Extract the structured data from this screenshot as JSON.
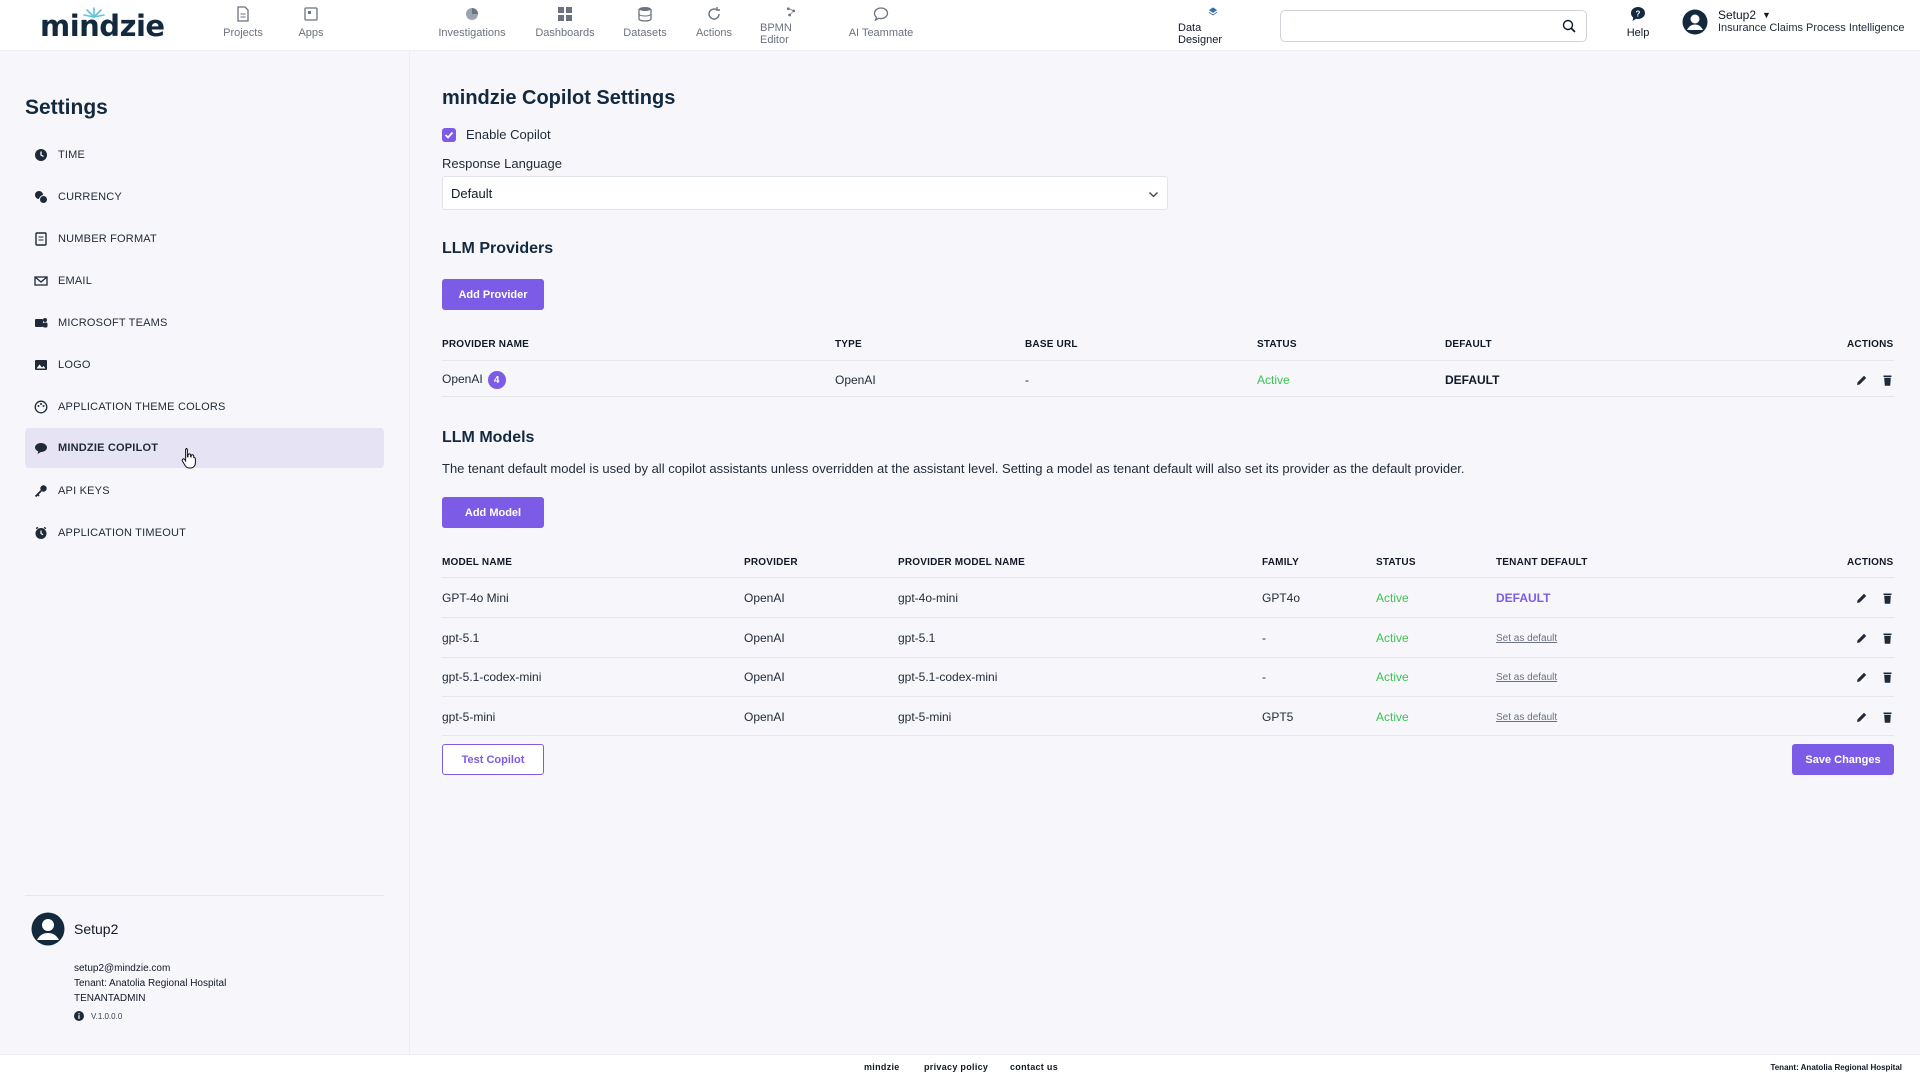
{
  "brand": {
    "logo_text": "mindzie"
  },
  "nav": {
    "items": [
      {
        "label": "Projects",
        "icon": "file-icon"
      },
      {
        "label": "Apps",
        "icon": "app-icon"
      },
      {
        "label": "Investigations",
        "icon": "chart-pie-icon"
      },
      {
        "label": "Dashboards",
        "icon": "grid-icon"
      },
      {
        "label": "Datasets",
        "icon": "database-icon"
      },
      {
        "label": "Actions",
        "icon": "refresh-icon"
      },
      {
        "label": "BPMN Editor",
        "icon": "bpmn-icon"
      },
      {
        "label": "AI Teammate",
        "icon": "chat-icon"
      },
      {
        "label": "Data Designer",
        "icon": "designer-icon"
      },
      {
        "label": "Help",
        "icon": "help-icon"
      }
    ],
    "search_value": "",
    "user_name": "Setup2",
    "user_org": "Insurance Claims Process Intelligence"
  },
  "sidebar": {
    "title": "Settings",
    "items": [
      {
        "label": "TIME",
        "icon": "clock-icon"
      },
      {
        "label": "CURRENCY",
        "icon": "currency-icon"
      },
      {
        "label": "NUMBER FORMAT",
        "icon": "number-format-icon"
      },
      {
        "label": "EMAIL",
        "icon": "envelope-icon"
      },
      {
        "label": "MICROSOFT TEAMS",
        "icon": "teams-icon"
      },
      {
        "label": "LOGO",
        "icon": "image-icon"
      },
      {
        "label": "APPLICATION THEME COLORS",
        "icon": "palette-icon"
      },
      {
        "label": "MINDZIE COPILOT",
        "icon": "copilot-icon",
        "active": true
      },
      {
        "label": "API KEYS",
        "icon": "key-icon"
      },
      {
        "label": "APPLICATION TIMEOUT",
        "icon": "timeout-icon"
      }
    ],
    "profile": {
      "name": "Setup2",
      "email": "setup2@mindzie.com",
      "tenant": "Tenant: Anatolia Regional Hospital",
      "role": "TENANTADMIN",
      "version": "V.1.0.0.0"
    }
  },
  "main": {
    "title": "mindzie Copilot Settings",
    "enable_copilot_label": "Enable Copilot",
    "enable_copilot_checked": true,
    "response_language_label": "Response Language",
    "response_language_value": "Default",
    "providers": {
      "title": "LLM Providers",
      "add_label": "Add Provider",
      "headers": [
        "PROVIDER NAME",
        "TYPE",
        "BASE URL",
        "STATUS",
        "DEFAULT",
        "ACTIONS"
      ],
      "rows": [
        {
          "name": "OpenAI",
          "badge": "4",
          "type": "OpenAI",
          "base_url": "-",
          "status": "Active",
          "default": "DEFAULT"
        }
      ]
    },
    "models": {
      "title": "LLM Models",
      "description": "The tenant default model is used by all copilot assistants unless overridden at the assistant level. Setting a model as tenant default will also set its provider as the default provider.",
      "add_label": "Add Model",
      "headers": [
        "MODEL NAME",
        "PROVIDER",
        "PROVIDER MODEL NAME",
        "FAMILY",
        "STATUS",
        "TENANT DEFAULT",
        "ACTIONS"
      ],
      "rows": [
        {
          "name": "GPT-4o Mini",
          "provider": "OpenAI",
          "provider_model": "gpt-4o-mini",
          "family": "GPT4o",
          "status": "Active",
          "tenant_default": "DEFAULT"
        },
        {
          "name": "gpt-5.1",
          "provider": "OpenAI",
          "provider_model": "gpt-5.1",
          "family": "-",
          "status": "Active",
          "tenant_default": "Set as default"
        },
        {
          "name": "gpt-5.1-codex-mini",
          "provider": "OpenAI",
          "provider_model": "gpt-5.1-codex-mini",
          "family": "-",
          "status": "Active",
          "tenant_default": "Set as default"
        },
        {
          "name": "gpt-5-mini",
          "provider": "OpenAI",
          "provider_model": "gpt-5-mini",
          "family": "GPT5",
          "status": "Active",
          "tenant_default": "Set as default"
        }
      ]
    },
    "test_label": "Test Copilot",
    "save_label": "Save Changes"
  },
  "footer": {
    "links": [
      "mindzie",
      "privacy policy",
      "contact us"
    ],
    "tenant": "Tenant: Anatolia Regional Hospital"
  },
  "colors": {
    "accent": "#7c5ce6",
    "active_status": "#3cc24f",
    "brand_dark": "#13293d"
  }
}
